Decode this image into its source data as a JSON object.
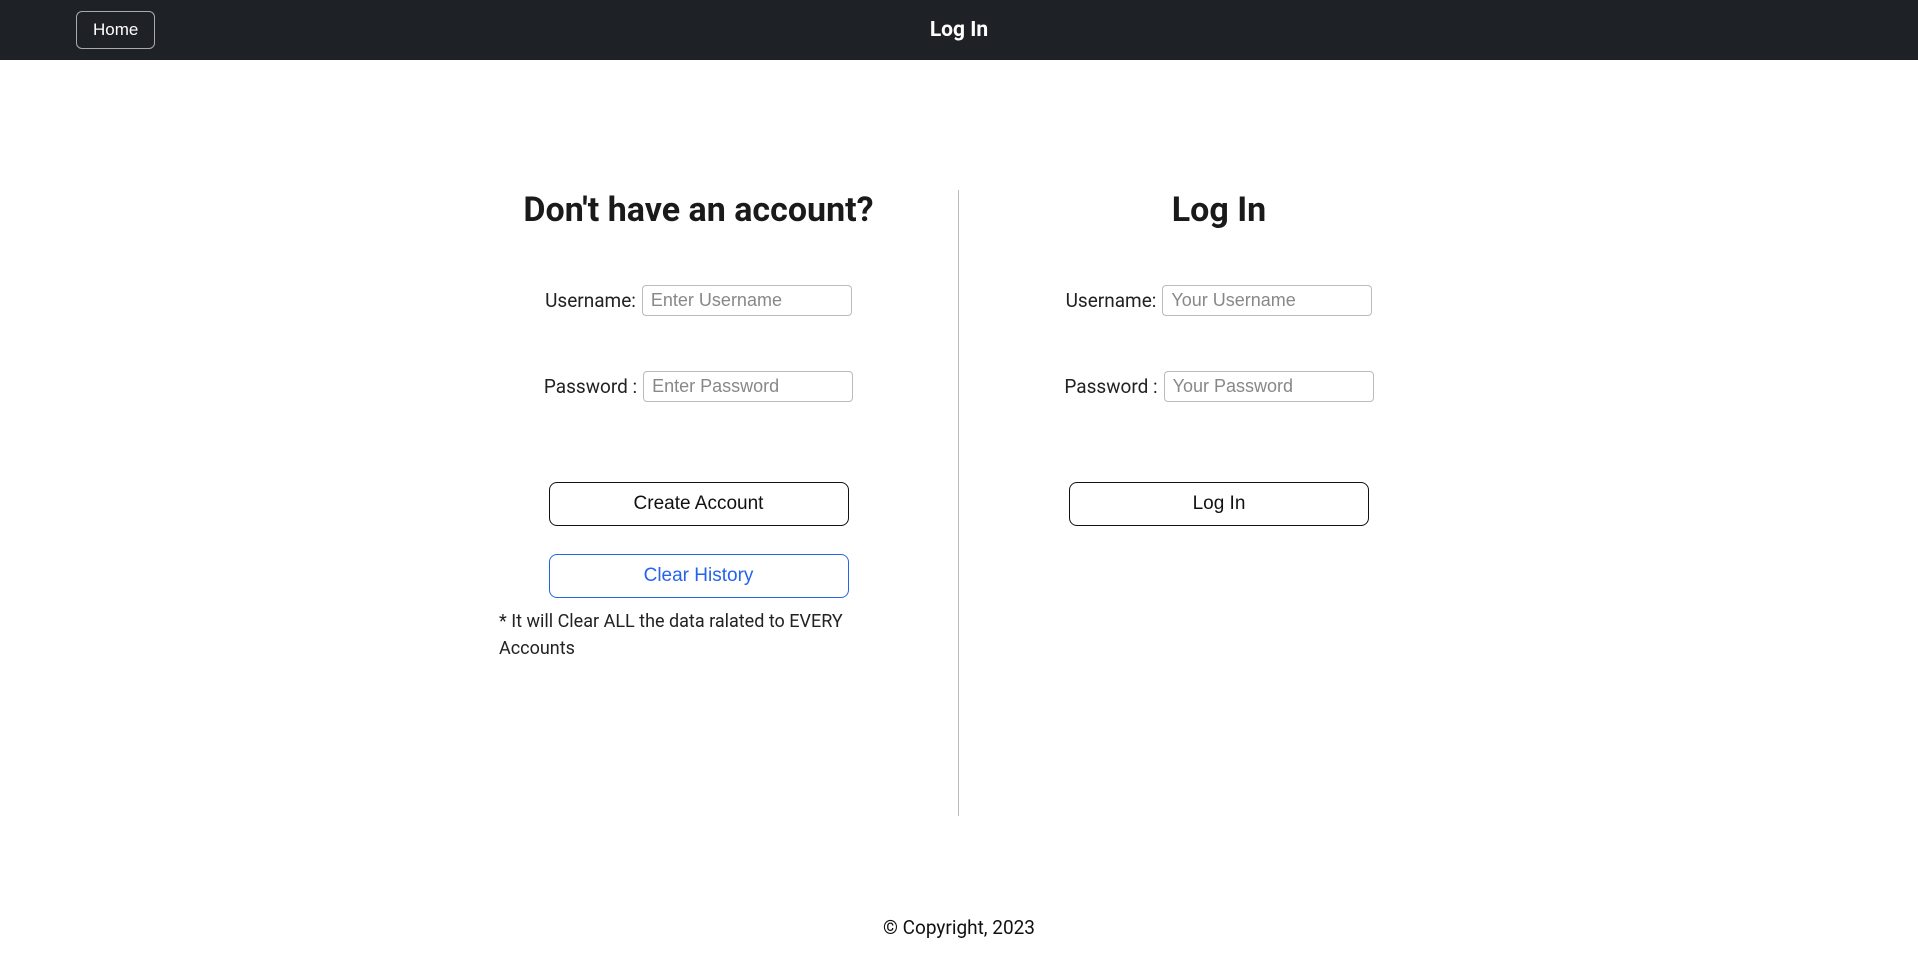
{
  "navbar": {
    "home_label": "Home",
    "title": "Log In"
  },
  "signup": {
    "heading": "Don't have an account?",
    "username_label": "Username:",
    "username_placeholder": "Enter Username",
    "username_value": "",
    "password_label": "Password :",
    "password_placeholder": "Enter Password",
    "password_value": "",
    "create_button": "Create Account",
    "clear_button": "Clear History",
    "warning": "* It will Clear ALL the data ralated to EVERY Accounts"
  },
  "login": {
    "heading": "Log In",
    "username_label": "Username:",
    "username_placeholder": "Your Username",
    "username_value": "",
    "password_label": "Password :",
    "password_placeholder": "Your Password",
    "password_value": "",
    "login_button": "Log In"
  },
  "footer": {
    "copyright": "© Copyright, 2023"
  }
}
